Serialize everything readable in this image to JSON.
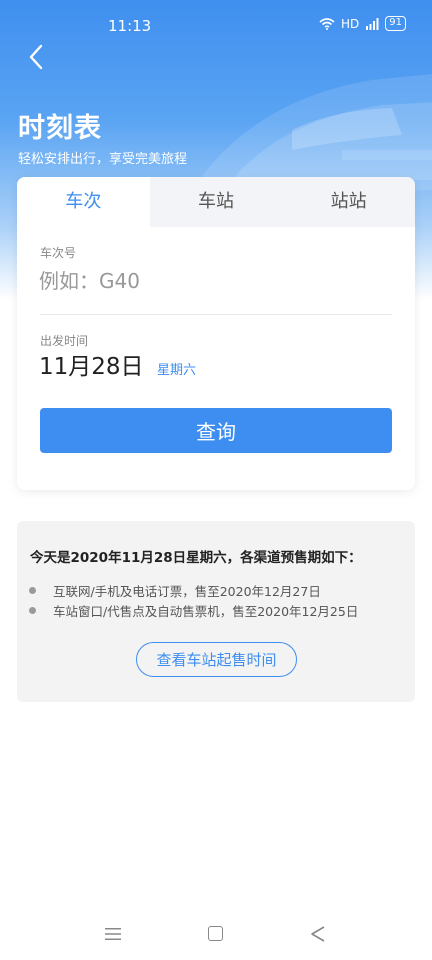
{
  "status_bar": {
    "time": "11:13",
    "network": "HD",
    "battery": "91"
  },
  "header": {
    "title": "时刻表",
    "subtitle": "轻松安排出行，享受完美旅程"
  },
  "tabs": [
    {
      "label": "车次",
      "active": true
    },
    {
      "label": "车站",
      "active": false
    },
    {
      "label": "站站",
      "active": false
    }
  ],
  "form": {
    "train_no_label": "车次号",
    "train_no_placeholder": "例如：G40",
    "departure_label": "出发时间",
    "date": "11月28日",
    "weekday": "星期六",
    "query_label": "查询"
  },
  "notice": {
    "title": "今天是2020年11月28日星期六，各渠道预售期如下：",
    "items": [
      "互联网/手机及电话订票，售至2020年12月27日",
      "车站窗口/代售点及自动售票机，售至2020年12月25日"
    ],
    "button_label": "查看车站起售时间"
  },
  "colors": {
    "accent": "#3d8ef0",
    "header_gradient_top": "#3f8fef"
  }
}
